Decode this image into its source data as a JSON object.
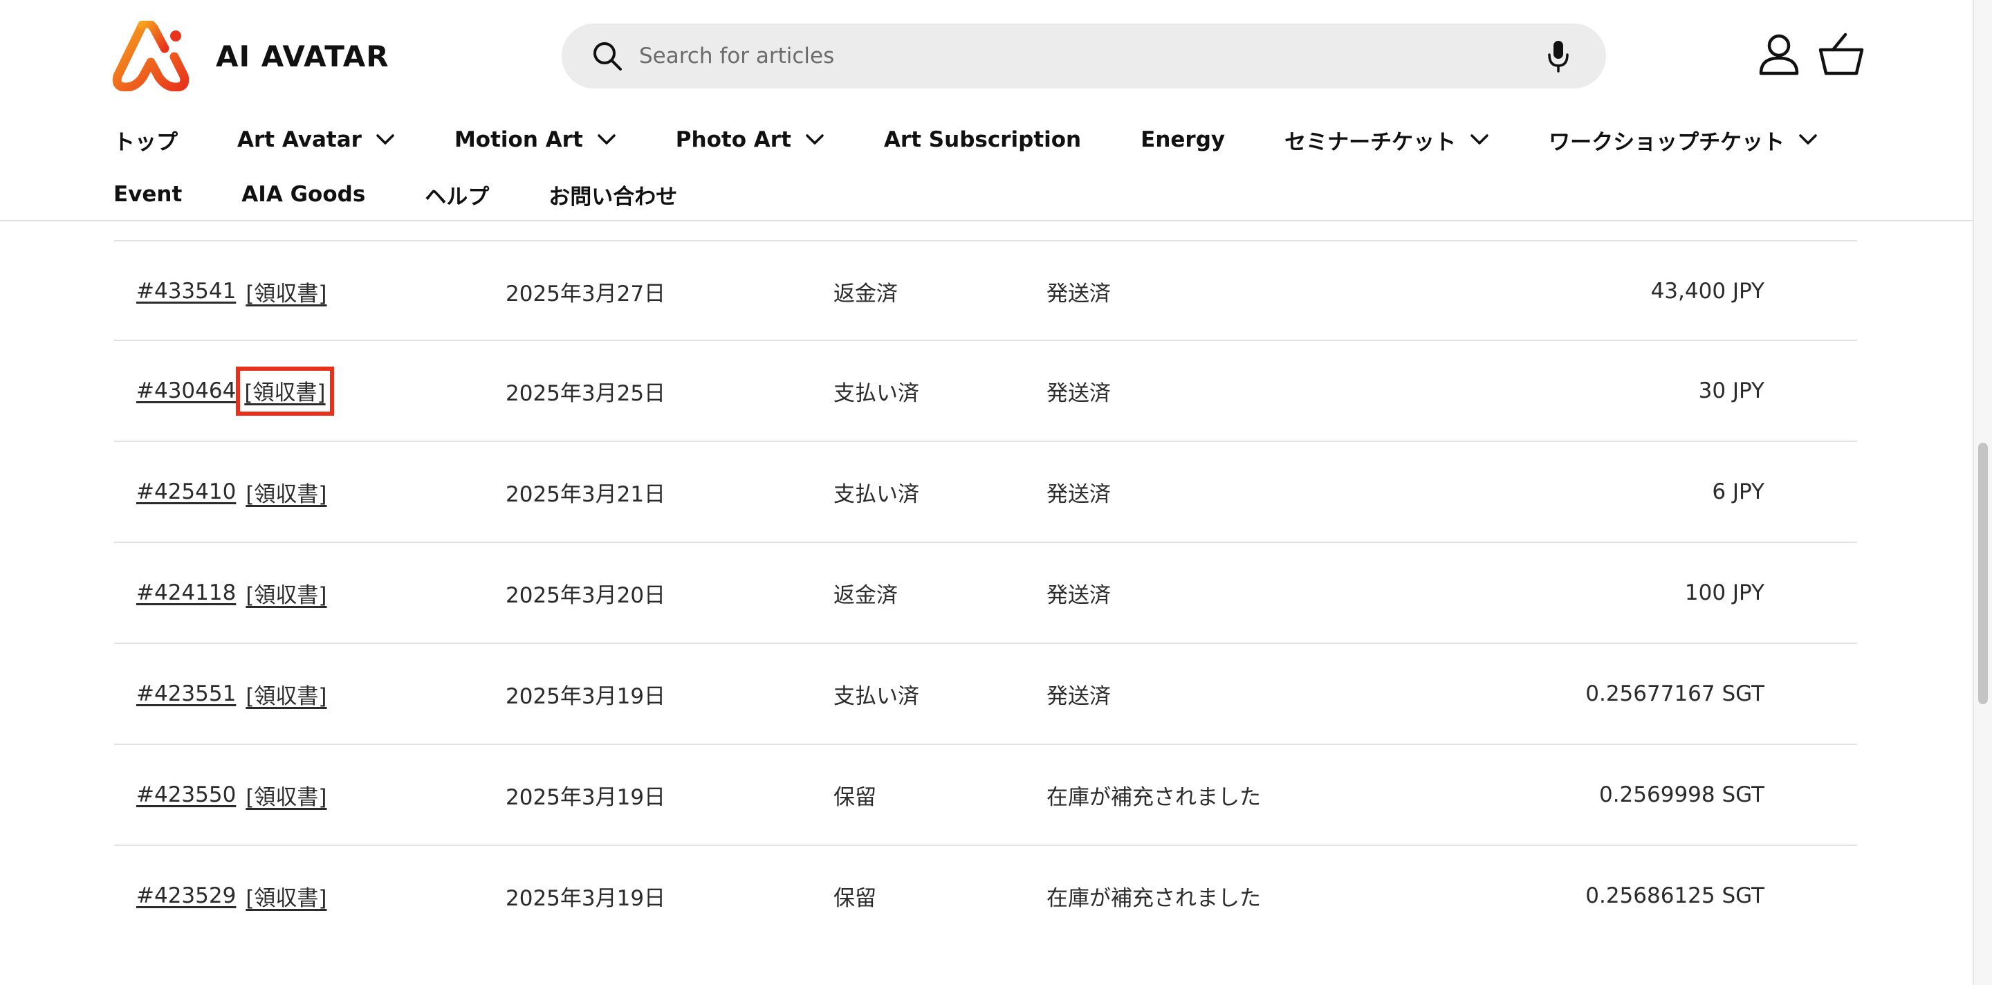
{
  "brand": {
    "name": "AI AVATAR",
    "logo_icon": "ai-avatar-logo-icon"
  },
  "search": {
    "placeholder": "Search for articles",
    "icon": "search-icon",
    "voice_icon": "mic-icon"
  },
  "header_icons": {
    "account": "account-icon",
    "cart": "cart-icon"
  },
  "nav": {
    "row1": [
      {
        "label": "トップ",
        "dropdown": false
      },
      {
        "label": "Art Avatar",
        "dropdown": true
      },
      {
        "label": "Motion Art",
        "dropdown": true
      },
      {
        "label": "Photo Art",
        "dropdown": true
      },
      {
        "label": "Art Subscription",
        "dropdown": false
      },
      {
        "label": "Energy",
        "dropdown": false
      },
      {
        "label": "セミナーチケット",
        "dropdown": true
      },
      {
        "label": "ワークショップチケット",
        "dropdown": true
      }
    ],
    "row2": [
      {
        "label": "Event",
        "dropdown": false
      },
      {
        "label": "AIA Goods",
        "dropdown": false
      },
      {
        "label": "ヘルプ",
        "dropdown": false
      },
      {
        "label": "お問い合わせ",
        "dropdown": false
      }
    ]
  },
  "orders": [
    {
      "number": "#433541",
      "receipt": "[領収書]",
      "date": "2025年3月27日",
      "payment_status": "返金済",
      "fulfillment_status": "発送済",
      "total": "43,400 JPY",
      "highlighted": false
    },
    {
      "number": "#430464",
      "receipt": "[領収書]",
      "date": "2025年3月25日",
      "payment_status": "支払い済",
      "fulfillment_status": "発送済",
      "total": "30 JPY",
      "highlighted": true
    },
    {
      "number": "#425410",
      "receipt": "[領収書]",
      "date": "2025年3月21日",
      "payment_status": "支払い済",
      "fulfillment_status": "発送済",
      "total": "6 JPY",
      "highlighted": false
    },
    {
      "number": "#424118",
      "receipt": "[領収書]",
      "date": "2025年3月20日",
      "payment_status": "返金済",
      "fulfillment_status": "発送済",
      "total": "100 JPY",
      "highlighted": false
    },
    {
      "number": "#423551",
      "receipt": "[領収書]",
      "date": "2025年3月19日",
      "payment_status": "支払い済",
      "fulfillment_status": "発送済",
      "total": "0.25677167 SGT",
      "highlighted": false
    },
    {
      "number": "#423550",
      "receipt": "[領収書]",
      "date": "2025年3月19日",
      "payment_status": "保留",
      "fulfillment_status": "在庫が補充されました",
      "total": "0.2569998 SGT",
      "highlighted": false
    },
    {
      "number": "#423529",
      "receipt": "[領収書]",
      "date": "2025年3月19日",
      "payment_status": "保留",
      "fulfillment_status": "在庫が補充されました",
      "total": "0.25686125 SGT",
      "highlighted": false
    }
  ],
  "colors": {
    "highlight": "#e8311a",
    "logo_gradient_start": "#f6a21e",
    "logo_gradient_end": "#e8341c"
  }
}
